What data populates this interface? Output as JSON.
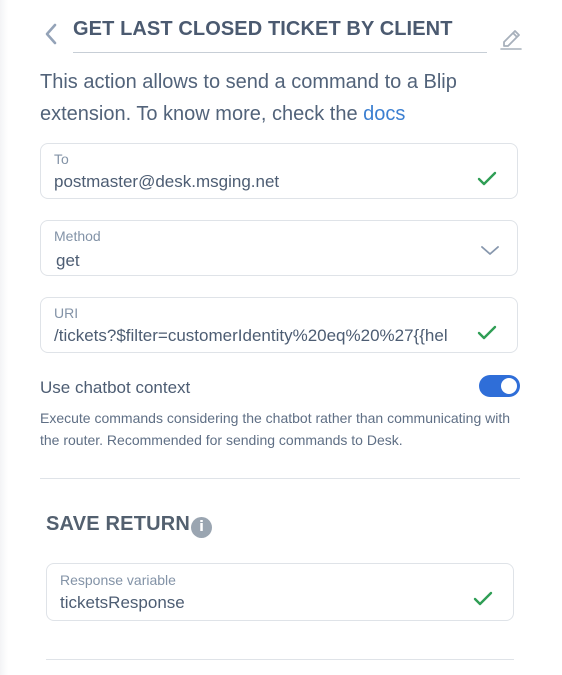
{
  "header": {
    "title": "GET LAST CLOSED TICKET BY CLIENT",
    "back_icon": "chevron-left-icon",
    "edit_icon": "pencil-icon"
  },
  "description": {
    "text": "This action allows to send a command to a Blip extension. To know more, check the",
    "link_label": "docs"
  },
  "fields": {
    "to": {
      "label": "To",
      "value": "postmaster@desk.msging.net",
      "status_icon": "check-icon"
    },
    "method": {
      "label": "Method",
      "value": "get",
      "control_icon": "chevron-down-icon"
    },
    "uri": {
      "label": "URI",
      "value": "/tickets?$filter=customerIdentity%20eq%20%27{{hel",
      "status_icon": "check-icon"
    }
  },
  "context_toggle": {
    "label": "Use chatbot context",
    "enabled": true,
    "help": "Execute commands considering the chatbot rather than communicating with the router. Recommended for sending commands to Desk."
  },
  "save_return": {
    "title": "SAVE RETURN",
    "info_icon_text": "i",
    "response_variable": {
      "label": "Response variable",
      "value": "ticketsResponse",
      "status_icon": "check-icon"
    }
  },
  "colors": {
    "primary_blue": "#2f6ed8",
    "link_blue": "#3b7fd1",
    "success_green": "#2f9e55",
    "text_slate": "#4d5d73",
    "border": "#dfe3e8"
  }
}
